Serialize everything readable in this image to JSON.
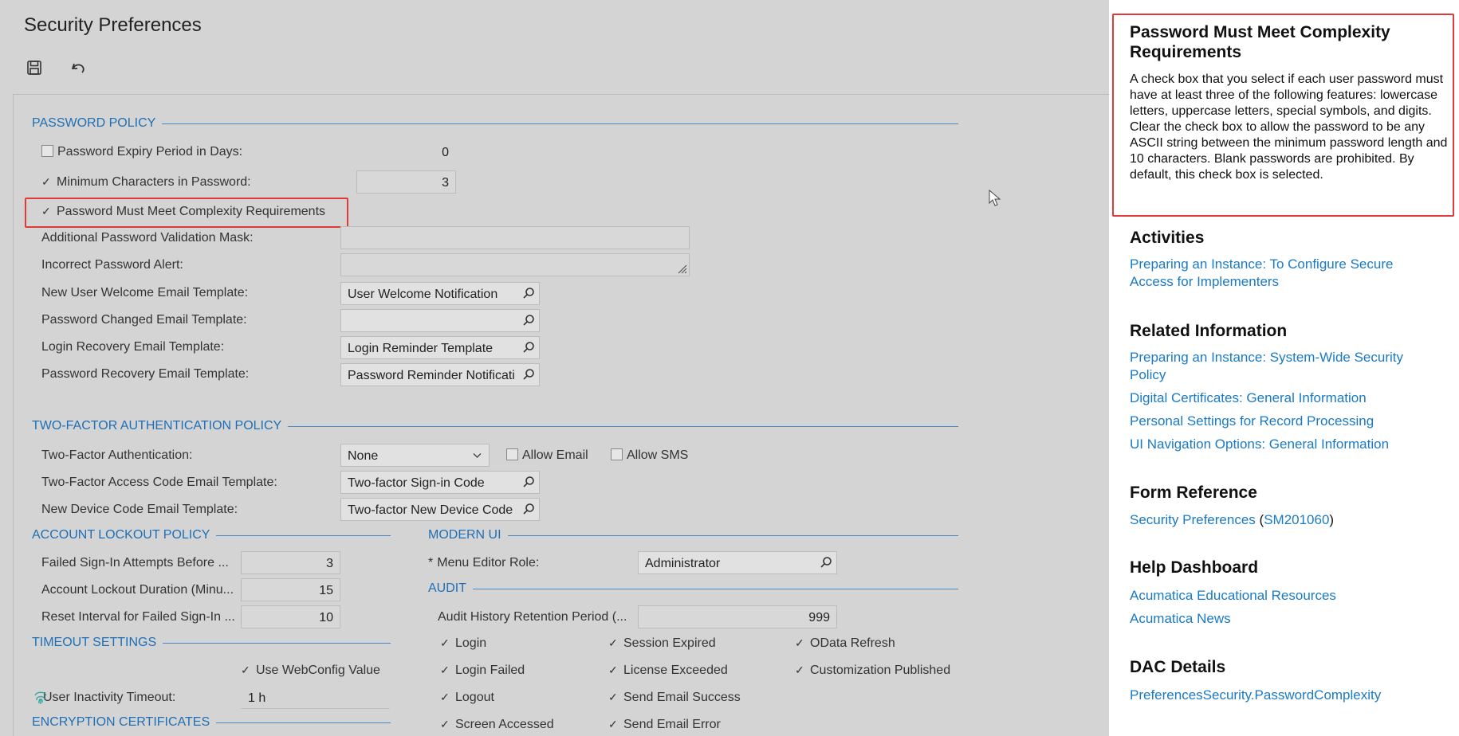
{
  "page": {
    "title": "Security Preferences"
  },
  "sections": {
    "password_policy": "PASSWORD POLICY",
    "two_factor": "TWO-FACTOR AUTHENTICATION POLICY",
    "lockout": "ACCOUNT LOCKOUT POLICY",
    "modern_ui": "MODERN UI",
    "audit": "AUDIT",
    "timeout": "TIMEOUT SETTINGS",
    "encryption": "ENCRYPTION CERTIFICATES"
  },
  "password": {
    "expiry_label": "Password Expiry Period in Days:",
    "expiry_value": "0",
    "min_chars_label": "Minimum Characters in Password:",
    "min_chars_value": "3",
    "complexity_label": "Password Must Meet Complexity Requirements",
    "mask_label": "Additional Password Validation Mask:",
    "alert_label": "Incorrect Password Alert:",
    "welcome_label": "New User Welcome Email Template:",
    "welcome_value": "User Welcome Notification",
    "changed_label": "Password Changed Email Template:",
    "changed_value": "",
    "login_rec_label": "Login Recovery Email Template:",
    "login_rec_value": "Login Reminder Template",
    "pwd_rec_label": "Password Recovery Email Template:",
    "pwd_rec_value": "Password Reminder Notificati"
  },
  "two_factor": {
    "auth_label": "Two-Factor Authentication:",
    "auth_value": "None",
    "allow_email": "Allow Email",
    "allow_sms": "Allow SMS",
    "access_label": "Two-Factor Access Code Email Template:",
    "access_value": "Two-factor Sign-in Code",
    "device_label": "New Device Code Email Template:",
    "device_value": "Two-factor New Device Code"
  },
  "lockout": {
    "failed_label": "Failed Sign-In Attempts Before ...",
    "failed_value": "3",
    "duration_label": "Account Lockout Duration (Minu...",
    "duration_value": "15",
    "reset_label": "Reset Interval for Failed Sign-In ...",
    "reset_value": "10"
  },
  "modern_ui": {
    "role_required": "*",
    "role_label": "Menu Editor Role:",
    "role_value": "Administrator"
  },
  "audit": {
    "retention_label": "Audit History Retention Period (...",
    "retention_value": "999",
    "col1": [
      "Login",
      "Login Failed",
      "Logout",
      "Screen Accessed"
    ],
    "col2": [
      "Session Expired",
      "License Exceeded",
      "Send Email Success",
      "Send Email Error"
    ],
    "col3": [
      "OData Refresh",
      "Customization Published"
    ]
  },
  "timeout": {
    "webconfig_label": "Use WebConfig Value",
    "inactivity_label": "User Inactivity Timeout:",
    "inactivity_value": "1 h"
  },
  "help": {
    "title_line1": "Password Must Meet Complexity",
    "title_line2": "Requirements",
    "description": "A check box that you select if each user password must have at least three of the following features: lowercase letters, uppercase letters, special symbols, and digits. Clear the check box to allow the password to be any ASCII string between the minimum password length and 10 characters. Blank passwords are prohibited. By default, this check box is selected.",
    "activities_heading": "Activities",
    "activities_link_1": "Preparing an Instance: To Configure Secure",
    "activities_link_2": "Access for Implementers",
    "related_heading": "Related Information",
    "related_1a": "Preparing an Instance: System-Wide Security",
    "related_1b": "Policy",
    "related_2": "Digital Certificates: General Information",
    "related_3": "Personal Settings for Record Processing",
    "related_4": "UI Navigation Options: General Information",
    "form_ref_heading": "Form Reference",
    "form_ref_link": "Security Preferences",
    "form_ref_open": " (",
    "form_ref_code": "SM201060",
    "form_ref_close": ")",
    "dashboard_heading": "Help Dashboard",
    "dashboard_1": "Acumatica Educational Resources",
    "dashboard_2": "Acumatica News",
    "dac_heading": "DAC Details",
    "dac_link": "PreferencesSecurity.PasswordComplexity"
  },
  "colors": {
    "link": "#1a7ac4",
    "section": "#1e6fb5",
    "highlight": "#e03a3a"
  }
}
